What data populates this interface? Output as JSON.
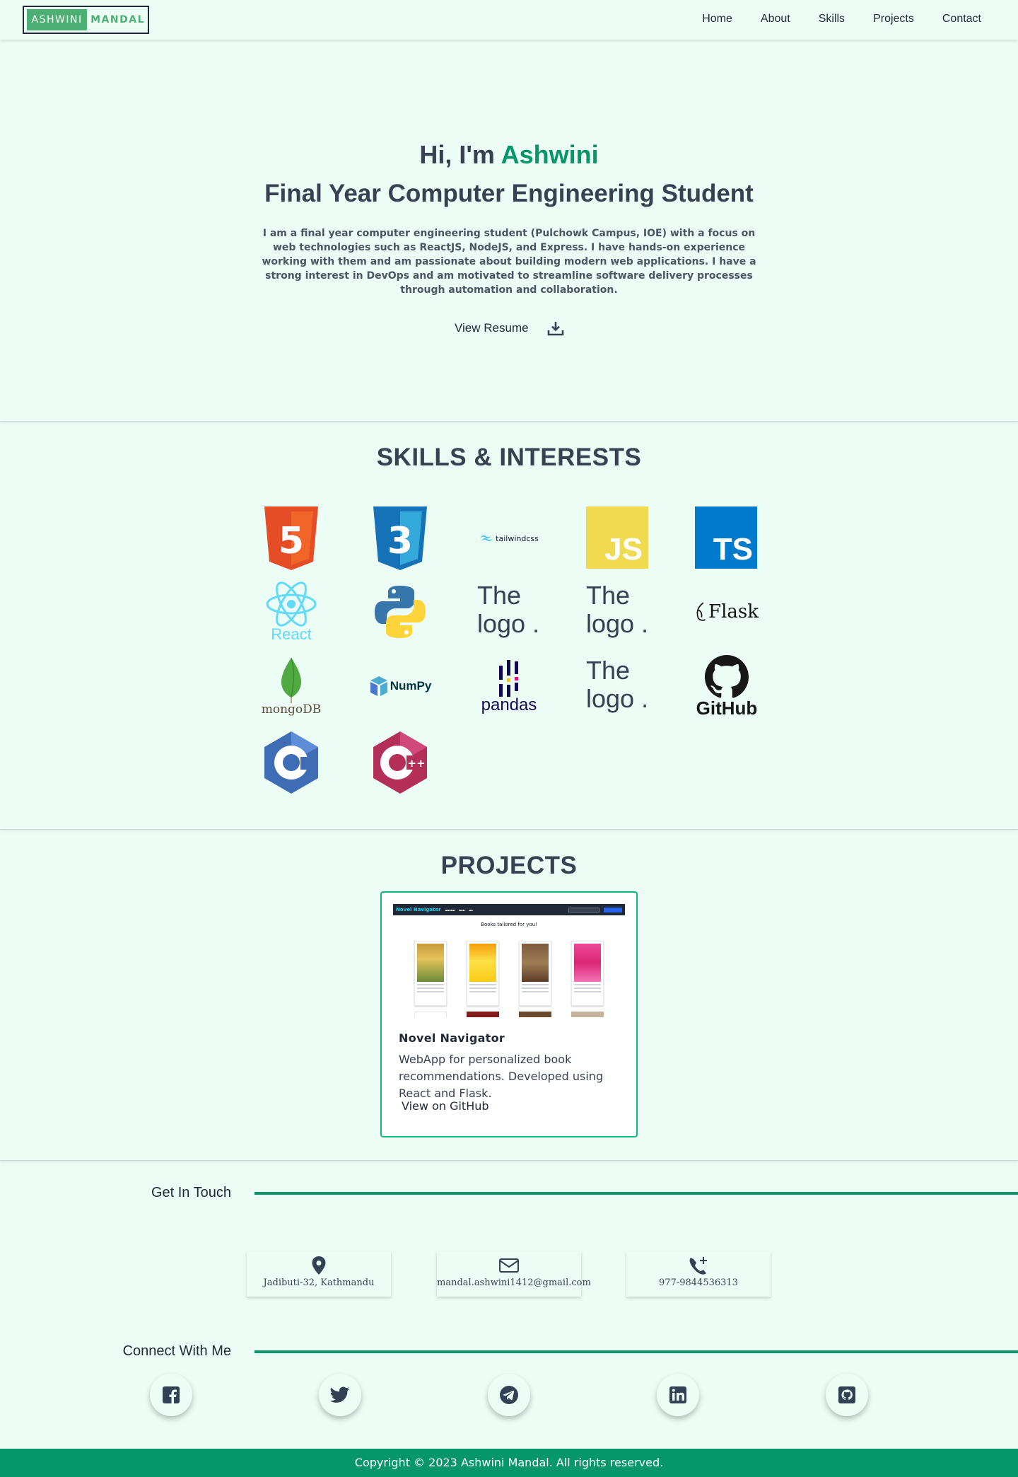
{
  "nav": {
    "logo_part1": "ASHWINI",
    "logo_part2": "MANDAL",
    "items": [
      "Home",
      "About",
      "Skills",
      "Projects",
      "Contact"
    ]
  },
  "hero": {
    "greeting_prefix": "Hi, I'm",
    "name": "Ashwini",
    "role": "Final Year Computer Engineering Student",
    "bio": "I am a final year computer engineering student (Pulchowk Campus, IOE) with a focus on web technologies such as ReactJS, NodeJS, and Express. I have hands-on experience working with them and am passionate about building modern web applications. I have a strong interest in DevOps and am motivated to streamline software delivery processes through automation and collaboration.",
    "resume_label": "View Resume"
  },
  "skills": {
    "title": "SKILLS & INTERESTS",
    "html_badge": "5",
    "css_badge": "3",
    "tailwind_label": "tailwindcss",
    "js_label": "JS",
    "ts_label": "TS",
    "react_label": "React",
    "broken_alt": "The logo .",
    "flask_label": "Flask",
    "mongo_label": "mongoDB",
    "numpy_label": "NumPy",
    "pandas_label": "pandas",
    "github_label": "GitHub",
    "cpp_label": "++"
  },
  "projects": {
    "title": "PROJECTS",
    "items": [
      {
        "name": "Novel Navigator",
        "description": "WebApp for personalized book recommendations. Developed using React and Flask.",
        "link_label": "View on GitHub",
        "screenshot": {
          "brand": "Novel Navigator",
          "tagline": "Books tailored for you!"
        }
      }
    ]
  },
  "contact": {
    "heading": "Get In Touch",
    "address": "Jadibuti-32, Kathmandu",
    "email": "mandal.ashwini1412@gmail.com",
    "phone": "977-9844536313"
  },
  "connect": {
    "heading": "Connect With Me",
    "icons": [
      "facebook-icon",
      "twitter-icon",
      "telegram-icon",
      "linkedin-icon",
      "github-icon"
    ]
  },
  "footer": {
    "text": "Copyright © 2023 Ashwini Mandal. All rights reserved."
  },
  "colors": {
    "background": "#ecfdf5",
    "accent": "#059669",
    "text": "#334155"
  }
}
